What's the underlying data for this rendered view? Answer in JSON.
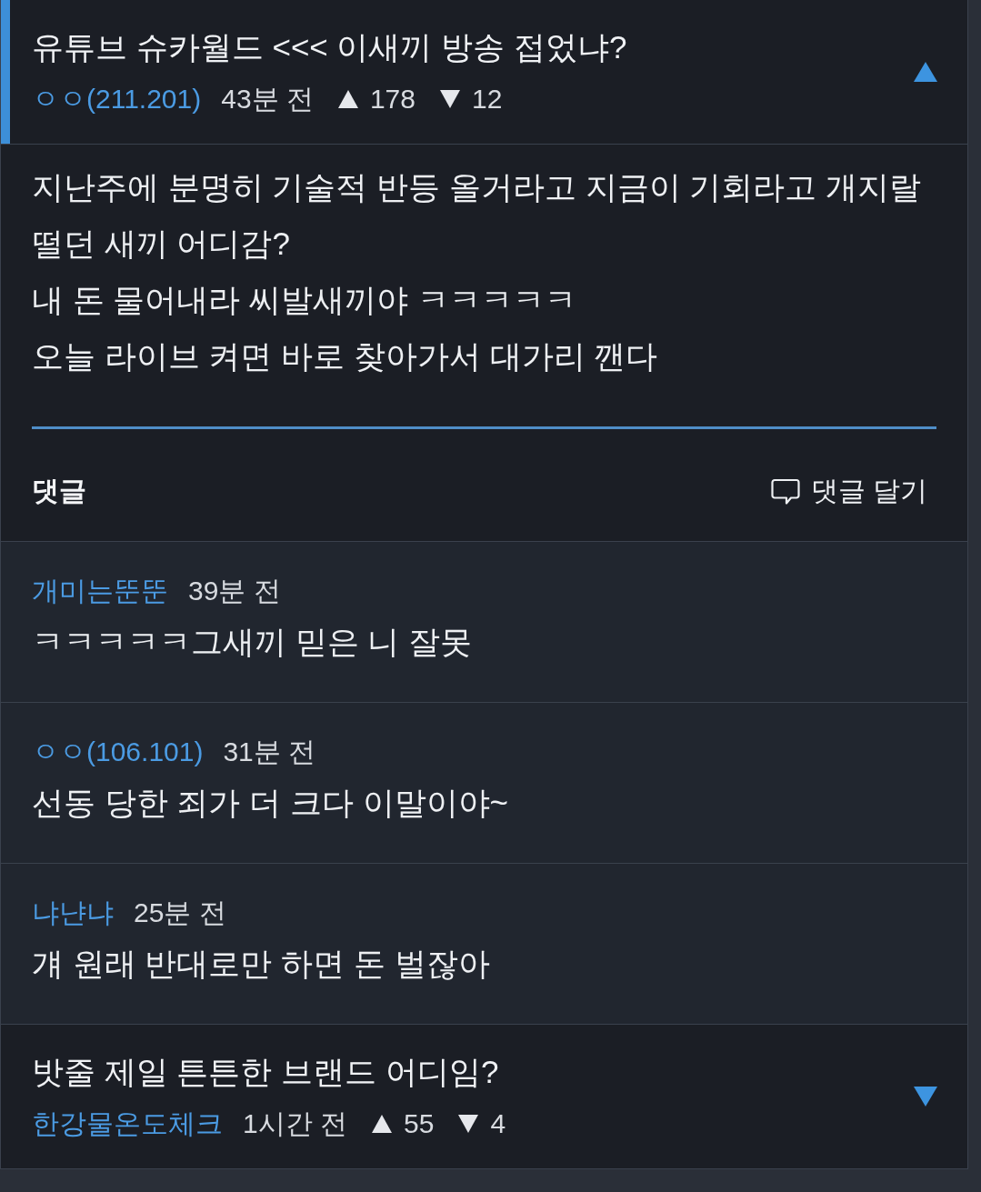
{
  "posts": [
    {
      "title": "유튜브 슈카월드 <<< 이새끼 방송 접었냐?",
      "author": "ㅇㅇ(211.201)",
      "time": "43분 전",
      "upvotes": "178",
      "downvotes": "12",
      "expanded": true,
      "body": [
        "지난주에 분명히 기술적 반등 올거라고 지금이 기회라고 개지랄 떨던 새끼 어디감?",
        "내 돈 물어내라 씨발새끼야 ㅋㅋㅋㅋㅋ",
        "오늘 라이브 켜면 바로 찾아가서 대가리 깬다"
      ],
      "comments_heading": "댓글",
      "reply_button": "댓글 달기",
      "comments": [
        {
          "author": "개미는뚠뚠",
          "time": "39분 전",
          "text": "ㅋㅋㅋㅋㅋ그새끼 믿은 니 잘못"
        },
        {
          "author": "ㅇㅇ(106.101)",
          "time": "31분 전",
          "text": "선동 당한 죄가 더 크다 이말이야~"
        },
        {
          "author": "냐냔냐",
          "time": "25분 전",
          "text": "걔 원래 반대로만 하면 돈 벌잖아"
        }
      ]
    },
    {
      "title": "밧줄 제일 튼튼한 브랜드 어디임?",
      "author": "한강물온도체크",
      "time": "1시간 전",
      "upvotes": "55",
      "downvotes": "4",
      "expanded": false
    }
  ]
}
